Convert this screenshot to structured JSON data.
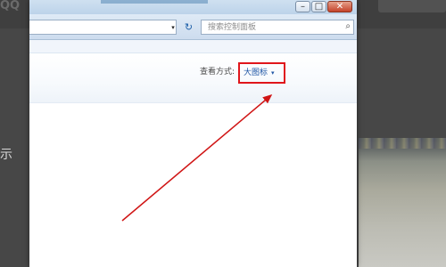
{
  "background": {
    "logo_text": "QQ",
    "side_char": "示"
  },
  "window": {
    "caption_buttons": {
      "minimize": "–",
      "maximize": "□",
      "close": "✕"
    },
    "address_bar": {
      "dropdown_glyph": "▾",
      "refresh_glyph": "↻",
      "search_placeholder": "搜索控制面板",
      "search_icon": "⌕"
    },
    "view": {
      "label": "查看方式:",
      "mode": "大图标",
      "caret": "▾"
    }
  },
  "annotation": {
    "arrow_color": "#d01515",
    "highlight_color": "#e0161b"
  }
}
